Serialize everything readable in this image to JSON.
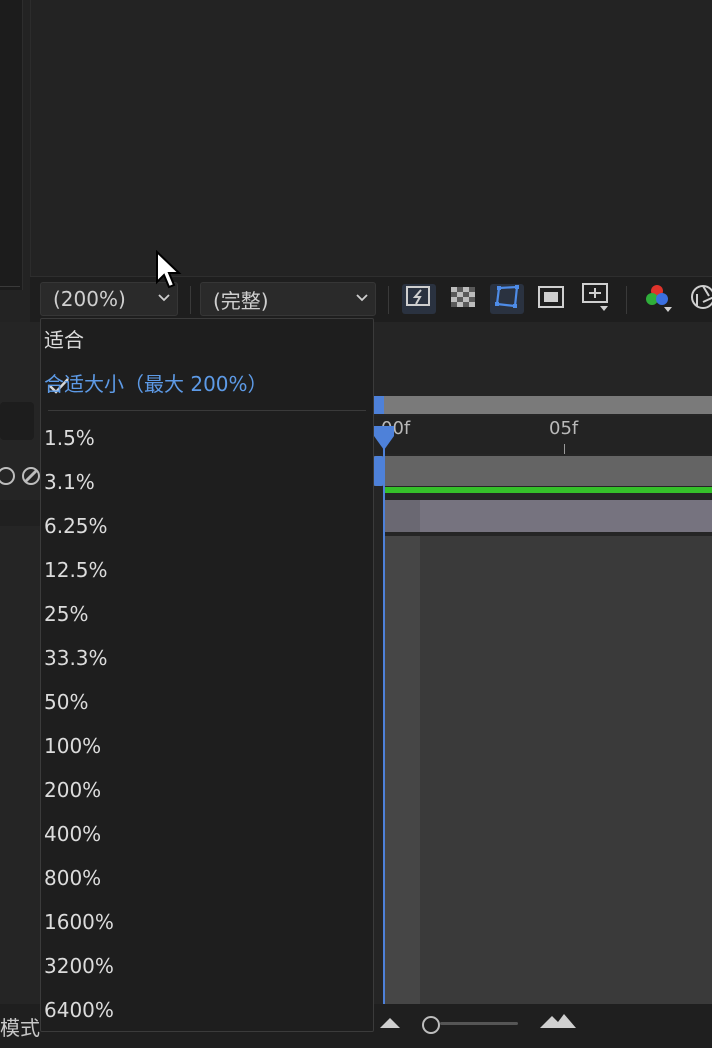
{
  "toolbar": {
    "zoom_value": "(200%)",
    "resolution_value": "(完整)"
  },
  "timeline": {
    "ruler_label_start": "00f",
    "ruler_label_05": "05f",
    "mode_label": "模式"
  },
  "zoom_menu": {
    "fit_label": "适合",
    "fit_up_to_label": "合适大小（最大 200%）",
    "items": [
      "1.5%",
      "3.1%",
      "6.25%",
      "12.5%",
      "25%",
      "33.3%",
      "50%",
      "100%",
      "200%",
      "400%",
      "800%",
      "1600%",
      "3200%",
      "6400%"
    ]
  },
  "colors": {
    "accent": "#5d9ae6",
    "playhead": "#4e81d9",
    "work_area_green": "#35c02a"
  },
  "icons": [
    "fast-previews-icon",
    "transparency-grid-icon",
    "mask-path-visibility-icon",
    "region-of-interest-icon",
    "grid-guides-icon",
    "channel-rgb-icon",
    "exposure-icon",
    "mountain-small-icon",
    "mountain-large-icon"
  ]
}
